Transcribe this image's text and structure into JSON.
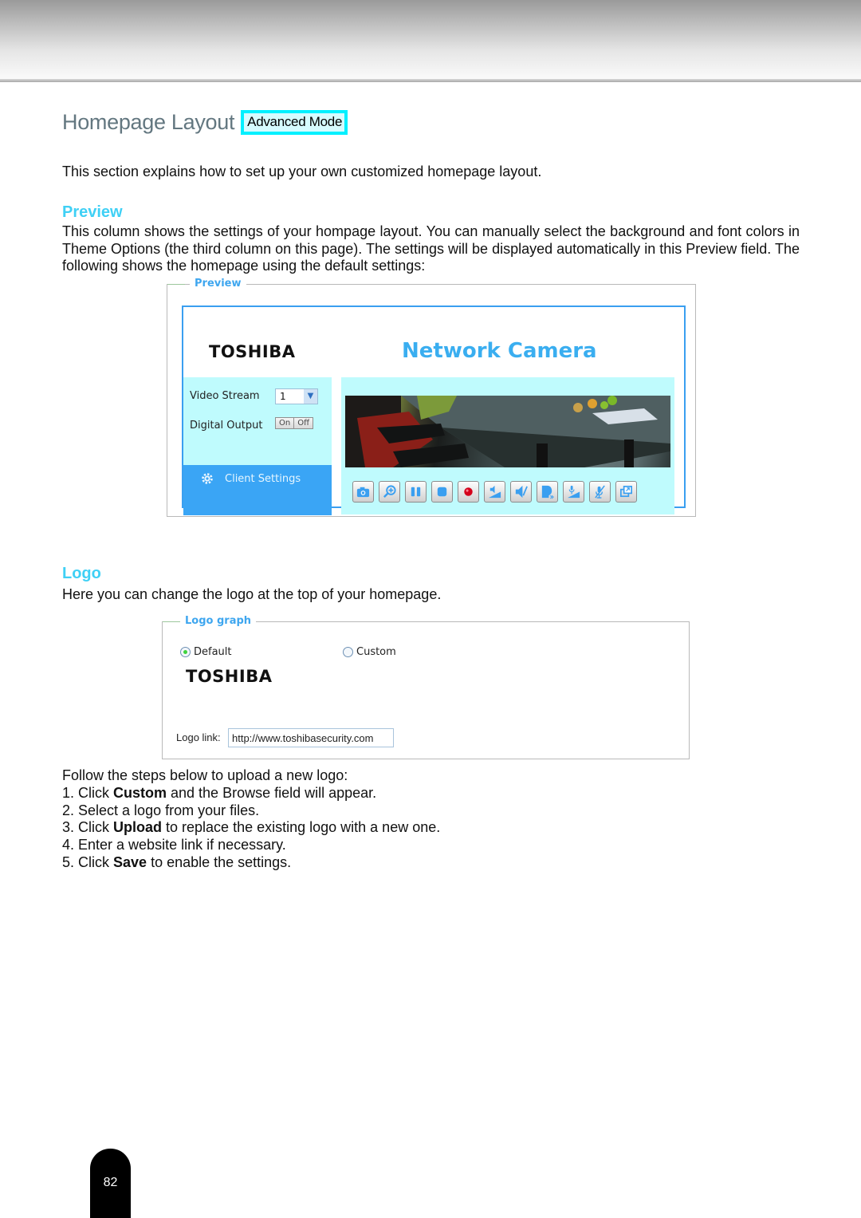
{
  "header": {
    "title": "Homepage Layout",
    "mode_badge": "Advanced Mode",
    "intro": "This section explains how to set up your own customized homepage layout."
  },
  "colors": {
    "heading_accent": "#3fd0f5",
    "title_gray": "#637780",
    "badge_border": "#00f0ff",
    "preview_blue": "#3aa5f5",
    "preview_light": "#bffbfd"
  },
  "preview_section": {
    "heading": "Preview",
    "description": "This column shows the settings of your hompage layout. You can manually select the background and font colors in Theme Options (the third column on this page). The settings will be displayed automatically in this Preview field. The following shows the homepage using the default settings:",
    "panel": {
      "legend": "Preview",
      "logo_text": "TOSHIBA",
      "site_title": "Network Camera",
      "video_stream_label": "Video Stream",
      "video_stream_value": "1",
      "digital_output_label": "Digital Output",
      "on_label": "On",
      "off_label": "Off",
      "client_settings_label": "Client Settings",
      "toolbar_icons": [
        "snapshot-icon",
        "digital-zoom-icon",
        "pause-icon",
        "stop-icon",
        "record-icon",
        "volume-icon",
        "mute-icon",
        "talk-icon",
        "mic-volume-icon",
        "mic-mute-icon",
        "fullscreen-icon"
      ]
    }
  },
  "logo_section": {
    "heading": "Logo",
    "description": "Here you can change the logo at the top of your homepage.",
    "panel": {
      "legend": "Logo graph",
      "option_default": "Default",
      "option_custom": "Custom",
      "selected": "Default",
      "logo_text": "TOSHIBA",
      "link_label": "Logo link:",
      "link_value": "http://www.toshibasecurity.com"
    },
    "steps_intro": "Follow the steps below to upload a new logo:",
    "steps": [
      {
        "pre": "1. Click ",
        "bold": "Custom",
        "post": " and the Browse field will appear."
      },
      {
        "pre": "2. Select a logo from your files.",
        "bold": "",
        "post": ""
      },
      {
        "pre": "3. Click ",
        "bold": "Upload",
        "post": " to replace the existing logo with a new one."
      },
      {
        "pre": "4. Enter a website link if necessary.",
        "bold": "",
        "post": ""
      },
      {
        "pre": "5. Click ",
        "bold": "Save",
        "post": " to enable the settings."
      }
    ]
  },
  "footer": {
    "page_number": "82"
  }
}
